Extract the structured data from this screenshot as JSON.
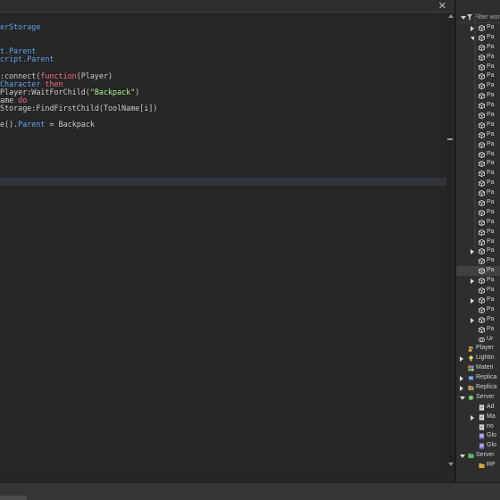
{
  "editor": {
    "close_glyph": "✕",
    "lines": [
      [
        {
          "t": "erStorage",
          "c": "prop"
        }
      ],
      [],
      [],
      [
        {
          "t": "t.Parent",
          "c": "prop"
        }
      ],
      [
        {
          "t": "cript.Parent",
          "c": "prop"
        }
      ],
      [],
      [
        {
          "t": ":connect(",
          "c": "plain"
        },
        {
          "t": "function",
          "c": "kw"
        },
        {
          "t": "(Player)",
          "c": "plain"
        }
      ],
      [
        {
          "t": "Character ",
          "c": "prop"
        },
        {
          "t": "then",
          "c": "kw"
        }
      ],
      [
        {
          "t": "Player:WaitForChild(",
          "c": "plain"
        },
        {
          "t": "\"Backpack\"",
          "c": "str"
        },
        {
          "t": ")",
          "c": "plain"
        }
      ],
      [
        {
          "t": "ame ",
          "c": "plain"
        },
        {
          "t": "do",
          "c": "kw"
        }
      ],
      [
        {
          "t": "Storage:FindFirstChild(ToolName[i])",
          "c": "plain"
        }
      ],
      [],
      [
        {
          "t": "e().",
          "c": "plain"
        },
        {
          "t": "Parent",
          "c": "prop"
        },
        {
          "t": " = Backpack",
          "c": "plain"
        }
      ],
      [],
      [],
      [],
      [],
      [],
      [],
      []
    ],
    "current_line_index": 19
  },
  "explorer": {
    "filter_placeholder": "Filter wor",
    "items": [
      {
        "label": "Pa",
        "indent": 2,
        "expander": "right",
        "icon": "part-icon"
      },
      {
        "label": "Pa",
        "indent": 2,
        "expander": "down",
        "icon": "part-icon"
      },
      {
        "label": "Pa",
        "indent": 2,
        "expander": "",
        "icon": "part-icon"
      },
      {
        "label": "Pa",
        "indent": 2,
        "expander": "",
        "icon": "part-icon"
      },
      {
        "label": "Pa",
        "indent": 2,
        "expander": "",
        "icon": "part-icon"
      },
      {
        "label": "Pa",
        "indent": 2,
        "expander": "",
        "icon": "part-icon"
      },
      {
        "label": "Pa",
        "indent": 2,
        "expander": "",
        "icon": "part-icon"
      },
      {
        "label": "Pa",
        "indent": 2,
        "expander": "",
        "icon": "part-icon"
      },
      {
        "label": "Pa",
        "indent": 2,
        "expander": "",
        "icon": "part-icon"
      },
      {
        "label": "Pa",
        "indent": 2,
        "expander": "",
        "icon": "part-icon"
      },
      {
        "label": "Pa",
        "indent": 2,
        "expander": "",
        "icon": "part-icon"
      },
      {
        "label": "Pa",
        "indent": 2,
        "expander": "",
        "icon": "part-icon"
      },
      {
        "label": "Pa",
        "indent": 2,
        "expander": "",
        "icon": "part-icon"
      },
      {
        "label": "Pa",
        "indent": 2,
        "expander": "",
        "icon": "part-icon"
      },
      {
        "label": "Pa",
        "indent": 2,
        "expander": "",
        "icon": "part-icon"
      },
      {
        "label": "Pa",
        "indent": 2,
        "expander": "",
        "icon": "part-icon"
      },
      {
        "label": "Pa",
        "indent": 2,
        "expander": "",
        "icon": "part-icon"
      },
      {
        "label": "Pa",
        "indent": 2,
        "expander": "",
        "icon": "part-icon"
      },
      {
        "label": "Pa",
        "indent": 2,
        "expander": "",
        "icon": "part-icon"
      },
      {
        "label": "Pa",
        "indent": 2,
        "expander": "",
        "icon": "part-icon"
      },
      {
        "label": "Pa",
        "indent": 2,
        "expander": "",
        "icon": "part-icon"
      },
      {
        "label": "Pa",
        "indent": 2,
        "expander": "",
        "icon": "part-icon"
      },
      {
        "label": "Pa",
        "indent": 2,
        "expander": "",
        "icon": "part-icon"
      },
      {
        "label": "Pa",
        "indent": 2,
        "expander": "right",
        "icon": "part-icon"
      },
      {
        "label": "Pa",
        "indent": 2,
        "expander": "",
        "icon": "part-icon"
      },
      {
        "label": "Pa",
        "indent": 2,
        "expander": "",
        "icon": "part-icon",
        "selected": true
      },
      {
        "label": "Pa",
        "indent": 2,
        "expander": "right",
        "icon": "part-icon"
      },
      {
        "label": "Pa",
        "indent": 2,
        "expander": "",
        "icon": "part-icon"
      },
      {
        "label": "Pa",
        "indent": 2,
        "expander": "right",
        "icon": "part-icon"
      },
      {
        "label": "Pa",
        "indent": 2,
        "expander": "",
        "icon": "part-icon"
      },
      {
        "label": "Pa",
        "indent": 2,
        "expander": "right",
        "icon": "part-icon"
      },
      {
        "label": "Pa",
        "indent": 2,
        "expander": "",
        "icon": "part-icon"
      },
      {
        "label": "Ur",
        "indent": 2,
        "expander": "",
        "icon": "union-icon"
      },
      {
        "label": "Player",
        "indent": 1,
        "expander": "",
        "icon": "players-icon"
      },
      {
        "label": "Lightin",
        "indent": 1,
        "expander": "right",
        "icon": "lighting-icon"
      },
      {
        "label": "Materi",
        "indent": 1,
        "expander": "",
        "icon": "material-icon"
      },
      {
        "label": "Replica",
        "indent": 1,
        "expander": "right",
        "icon": "replicated-first-icon"
      },
      {
        "label": "Replica",
        "indent": 1,
        "expander": "right",
        "icon": "replicated-storage-icon"
      },
      {
        "label": "Server",
        "indent": 1,
        "expander": "down",
        "icon": "server-script-service-icon"
      },
      {
        "label": "Ad",
        "indent": 2,
        "expander": "",
        "icon": "script-icon"
      },
      {
        "label": "Ma",
        "indent": 2,
        "expander": "right",
        "icon": "script-icon"
      },
      {
        "label": "no",
        "indent": 2,
        "expander": "",
        "icon": "script-icon"
      },
      {
        "label": "Glo",
        "indent": 2,
        "expander": "",
        "icon": "module-icon"
      },
      {
        "label": "Glo",
        "indent": 2,
        "expander": "",
        "icon": "module-icon"
      },
      {
        "label": "Server",
        "indent": 1,
        "expander": "down",
        "icon": "server-storage-icon"
      },
      {
        "label": "RP",
        "indent": 2,
        "expander": "",
        "icon": "folder-icon"
      }
    ]
  },
  "colors": {
    "keyword": "#f86d7c",
    "property": "#61a1f1",
    "string": "#adf195",
    "text": "#cccccc"
  }
}
